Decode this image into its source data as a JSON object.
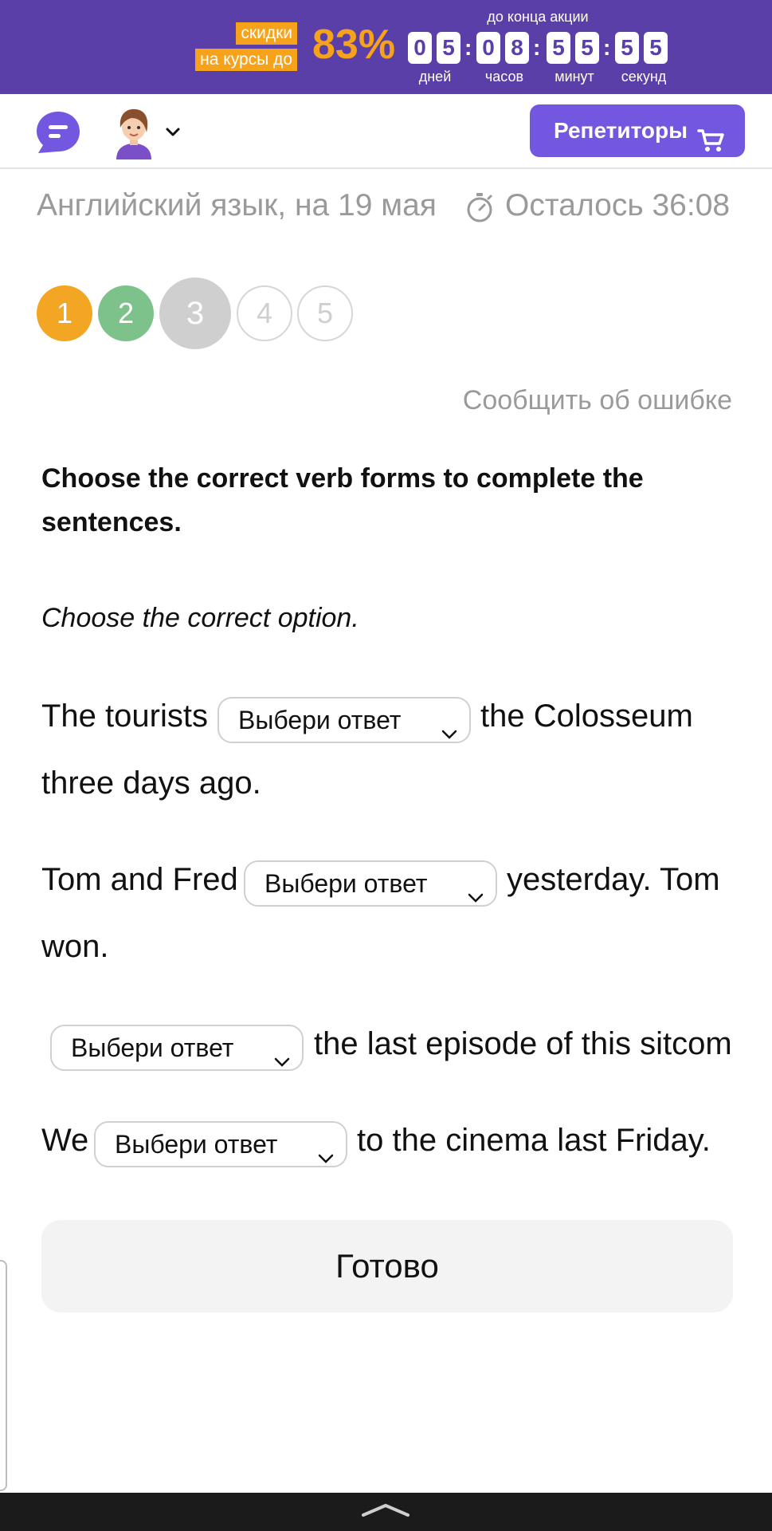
{
  "promo": {
    "tag_line1": "скидки",
    "tag_line2": "на курсы до",
    "percent": "83%",
    "until_label": "до конца акции",
    "days": [
      "0",
      "5"
    ],
    "hours": [
      "0",
      "8"
    ],
    "minutes": [
      "5",
      "5"
    ],
    "seconds": [
      "5",
      "5"
    ],
    "unit_days": "дней",
    "unit_hours": "часов",
    "unit_minutes": "минут",
    "unit_seconds": "секунд",
    "colors": {
      "background": "#5b3fa8",
      "accent": "#f6a21a"
    }
  },
  "header": {
    "chat_icon": "chat-bubble-icon",
    "avatar_icon": "user-avatar",
    "tutors_label": "Репетиторы",
    "cart_icon": "shopping-cart-icon",
    "button_color": "#7357e0"
  },
  "task": {
    "title": "Английский язык, на 19 мая",
    "timer_label": "Осталось 36:08",
    "steps": [
      "1",
      "2",
      "3",
      "4",
      "5"
    ],
    "current_step": "3",
    "report_label": "Сообщить об ошибке",
    "instruction": "Choose the correct verb forms to complete the sentences.",
    "hint": "Choose the correct option.",
    "select_placeholder": "Выбери ответ",
    "sentences": [
      {
        "before": "The tourists",
        "after": "the Colosseum",
        "continuation": "three days ago."
      },
      {
        "before": "Tom and Fred",
        "after": "yesterday. Tom",
        "continuation": "won."
      },
      {
        "before": "",
        "after": "the last episode of this sitcom?"
      },
      {
        "before": "We",
        "after": "to the cinema last Friday."
      }
    ],
    "done_label": "Готово"
  }
}
